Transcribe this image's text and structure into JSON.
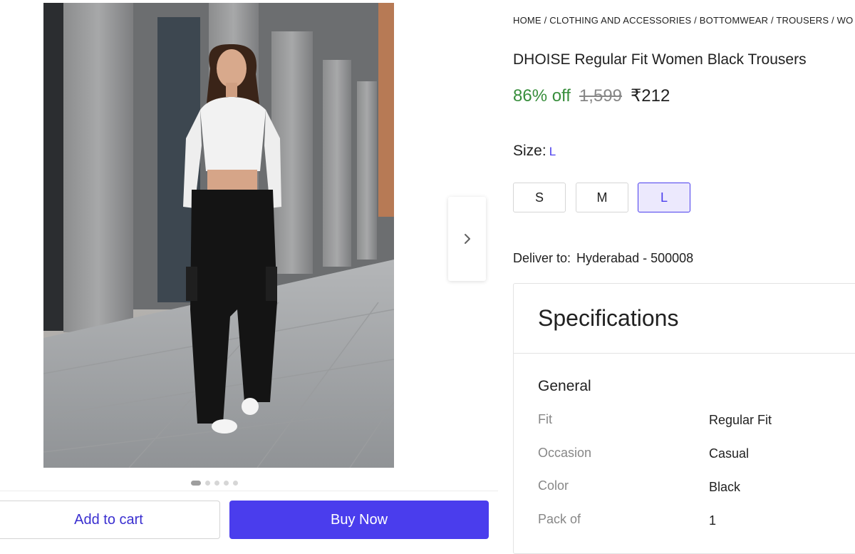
{
  "breadcrumb": "HOME / CLOTHING AND ACCESSORIES / BOTTOMWEAR / TROUSERS / WO",
  "product": {
    "title": "DHOISE Regular Fit Women Black Trousers",
    "discount": "86% off",
    "mrp": "1,599",
    "price": "₹212"
  },
  "size": {
    "label": "Size:",
    "selected": "L",
    "options": [
      "S",
      "M",
      "L"
    ]
  },
  "delivery": {
    "label": "Deliver to:",
    "location": "Hyderabad - 500008"
  },
  "specifications": {
    "title": "Specifications",
    "group": "General",
    "rows": [
      {
        "label": "Fit",
        "value": "Regular Fit"
      },
      {
        "label": "Occasion",
        "value": "Casual"
      },
      {
        "label": "Color",
        "value": "Black"
      },
      {
        "label": "Pack of",
        "value": "1"
      }
    ]
  },
  "gallery": {
    "image_alt": "Woman in white crop top and black cargo trousers walking on city sidewalk",
    "total_images": 5,
    "active_index": 0
  },
  "actions": {
    "add_to_cart": "Add to cart",
    "buy_now": "Buy Now"
  },
  "colors": {
    "accent": "#4a3ded",
    "discount_green": "#388e3c",
    "muted": "#878787"
  },
  "icons": {
    "next": "chevron-right-icon"
  }
}
